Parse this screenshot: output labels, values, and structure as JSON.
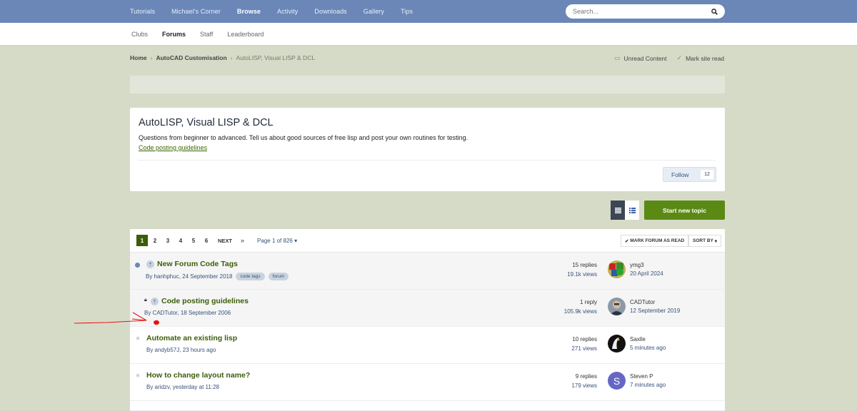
{
  "topnav": {
    "items": [
      "Tutorials",
      "Michael's Corner",
      "Browse",
      "Activity",
      "Downloads",
      "Gallery",
      "Tips"
    ],
    "active": "Browse",
    "search_placeholder": "Search..."
  },
  "subnav": {
    "items": [
      "Clubs",
      "Forums",
      "Staff",
      "Leaderboard"
    ],
    "active": "Forums"
  },
  "breadcrumb": {
    "home": "Home",
    "section": "AutoCAD Customisation",
    "current": "AutoLISP, Visual LISP & DCL",
    "unread": "Unread Content",
    "mark_read": "Mark site read"
  },
  "forum": {
    "title": "AutoLISP, Visual LISP & DCL",
    "description": "Questions from beginner to advanced. Tell us about good sources of free lisp and post your own routines for testing.",
    "guidelines_link": "Code posting guidelines",
    "follow_label": "Follow",
    "follow_count": "12"
  },
  "actions": {
    "new_topic": "Start new topic"
  },
  "pagination": {
    "pages": [
      "1",
      "2",
      "3",
      "4",
      "5",
      "6"
    ],
    "active_page": "1",
    "next": "NEXT",
    "last": "»",
    "page_of": "Page 1 of 826",
    "mark_forum_read": "MARK FORUM AS READ",
    "sort_by": "SORT BY"
  },
  "topics": [
    {
      "title": "New Forum Code Tags",
      "meta": "By hanhphuc, 24 September 2018",
      "tags": [
        "code tags",
        "forum"
      ],
      "replies": "15 replies",
      "views": "19.1k views",
      "last_user": "ymg3",
      "last_date": "20 April 2024",
      "unread": true,
      "pinned": true,
      "locked": false
    },
    {
      "title": "Code posting guidelines",
      "meta": "By CADTutor, 18 September 2006",
      "tags": [],
      "replies": "1 reply",
      "views": "105.9k views",
      "last_user": "CADTutor",
      "last_date": "12 September 2019",
      "unread": false,
      "pinned": true,
      "locked": true
    },
    {
      "title": "Automate an existing lisp",
      "meta": "By andyb57J, 23 hours ago",
      "tags": [],
      "replies": "10 replies",
      "views": "271 views",
      "last_user": "Saxlle",
      "last_date": "5 minutes ago",
      "unread": false,
      "pinned": false,
      "locked": false
    },
    {
      "title": "How to change layout name?",
      "meta": "By aridzv, yesterday at 11:28",
      "tags": [],
      "replies": "9 replies",
      "views": "179 views",
      "last_user": "Steven P",
      "last_date": "7 minutes ago",
      "avatar_letter": "S",
      "unread": false,
      "pinned": false,
      "locked": false
    }
  ],
  "colors": {
    "topbar": "#6a87b8",
    "accent_green": "#5a8a14",
    "page_bg": "#d6dbc8",
    "annotation_red": "#e8140f"
  }
}
